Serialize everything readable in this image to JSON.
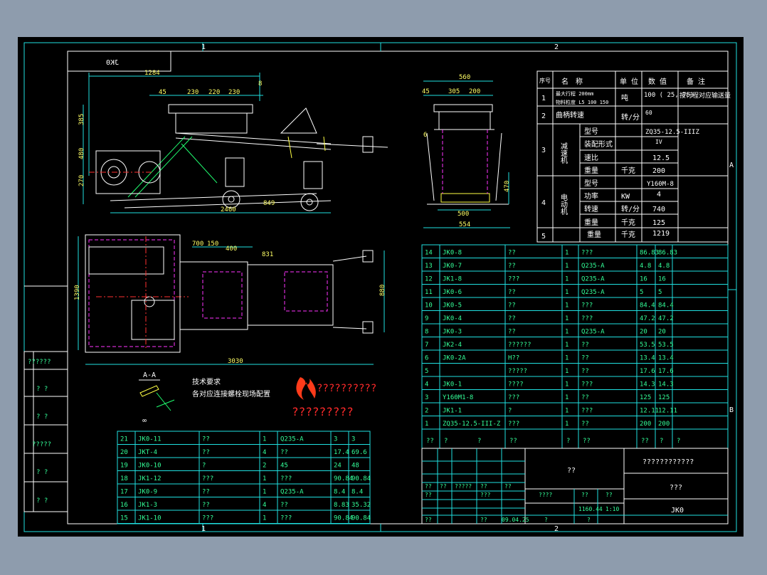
{
  "title_box": {
    "text": "JK0",
    "mirrored": true
  },
  "zones": {
    "top_1": "1",
    "top_2": "2",
    "bottom_1": "1",
    "bottom_2": "2",
    "right_a": "A",
    "right_b": "B"
  },
  "dims": {
    "side_overall": "1284",
    "side_45": "45",
    "side_230a": "230",
    "side_220": "220",
    "side_230b": "230",
    "side_8": "8",
    "side_385": "385",
    "side_480": "480",
    "side_270": "270",
    "side_2460": "2460",
    "side_849": "849",
    "end_560": "560",
    "end_45": "45",
    "end_305": "305",
    "end_200": "200",
    "end_6": "6",
    "end_470": "470",
    "end_500": "500",
    "end_554": "554",
    "plan_700": "700",
    "plan_150": "150",
    "plan_400": "400",
    "plan_831": "831",
    "plan_1390": "1390",
    "plan_880": "880",
    "plan_3030": "3030"
  },
  "section_label": "A-A",
  "notes": {
    "heading": "技术要求",
    "line1": "各对应连接螺栓现场配置"
  },
  "logo": {
    "text1": "??????????",
    "text2": "?????????",
    "colors": {
      "flame": "#ff3b1a",
      "text": "#ff2a2a"
    }
  },
  "spec_table": {
    "headers": [
      "序号",
      "名　称",
      "单 位",
      "数 值",
      "备 注"
    ],
    "rows": [
      {
        "no": "1",
        "name_l1": "最大行程 200mm",
        "name_l2": "物料粒度 L5 100 150",
        "unit": "吨",
        "value": "100 ( 25, 75)",
        "note": "按行程对应输送量"
      },
      {
        "no": "2",
        "name_l1": "曲柄转速",
        "unit": "转/分",
        "value": "60"
      },
      {
        "no": "3",
        "group": "减速机",
        "sub": [
          {
            "name": "型号",
            "unit": "",
            "value": "ZQ35-12.5-IIIZ"
          },
          {
            "name": "装配形式",
            "unit": "",
            "value": "IV"
          },
          {
            "name": "速比",
            "unit": "",
            "value": "12.5"
          },
          {
            "name": "重量",
            "unit": "千克",
            "value": "200"
          }
        ]
      },
      {
        "no": "4",
        "group": "电动机",
        "sub": [
          {
            "name": "型号",
            "unit": "",
            "value": "Y160M-8"
          },
          {
            "name": "功率",
            "unit": "KW",
            "value": "4"
          },
          {
            "name": "转速",
            "unit": "转/分",
            "value": "740"
          },
          {
            "name": "重量",
            "unit": "千克",
            "value": "125"
          }
        ]
      },
      {
        "no": "5",
        "name": "重量",
        "unit": "千克",
        "value": "1219"
      }
    ]
  },
  "bom_upper": [
    [
      "14",
      "JK0-8",
      "??",
      "1",
      "???",
      "86.83",
      "86.83"
    ],
    [
      "13",
      "JK0-7",
      "??",
      "1",
      "Q235-A",
      "4.8",
      "4.8"
    ],
    [
      "12",
      "JK1-8",
      "???",
      "1",
      "Q235-A",
      "16",
      "16"
    ],
    [
      "11",
      "JK0-6",
      "??",
      "1",
      "Q235-A",
      "5",
      "5"
    ],
    [
      "10",
      "JK0-5",
      "??",
      "1",
      "???",
      "84.4",
      "84.4"
    ],
    [
      "9",
      "JK0-4",
      "??",
      "1",
      "???",
      "47.2",
      "47.2"
    ],
    [
      "8",
      "JK0-3",
      "??",
      "1",
      "Q235-A",
      "20",
      "20"
    ],
    [
      "7",
      "JK2-4",
      "??????",
      "1",
      "??",
      "53.5",
      "53.5"
    ],
    [
      "6",
      "JK0-2A",
      "H??",
      "1",
      "??",
      "13.4",
      "13.4"
    ],
    [
      "5",
      "",
      "?????",
      "1",
      "??",
      "17.6",
      "17.6"
    ],
    [
      "4",
      "JK0-1",
      "????",
      "1",
      "???",
      "14.3",
      "14.3"
    ],
    [
      "3",
      "Y160M1-8",
      "???",
      "1",
      "??",
      "125",
      "125"
    ],
    [
      "2",
      "JK1-1",
      "?",
      "1",
      "???",
      "12.11",
      "12.11"
    ],
    [
      "1",
      "ZQ35-12.5-III-Z",
      "???",
      "1",
      "??",
      "200",
      "200"
    ]
  ],
  "bom_upper_header": [
    "??",
    "?",
    "?",
    "??",
    "?",
    "??",
    "??",
    "?",
    "?"
  ],
  "bom_lower": [
    [
      "21",
      "JK0-11",
      "??",
      "1",
      "Q235-A",
      "3",
      "3"
    ],
    [
      "20",
      "JKT-4",
      "??",
      "4",
      "??",
      "17.4",
      "69.6"
    ],
    [
      "19",
      "JK0-10",
      "?",
      "2",
      "45",
      "24",
      "48"
    ],
    [
      "18",
      "JK1-12",
      "???",
      "1",
      "???",
      "90.84",
      "90.84"
    ],
    [
      "17",
      "JK0-9",
      "??",
      "1",
      "Q235-A",
      "8.4",
      "8.4"
    ],
    [
      "16",
      "JK1-3",
      "??",
      "4",
      "??",
      "8.83",
      "35.32"
    ],
    [
      "15",
      "JK1-10",
      "???",
      "1",
      "???",
      "90.84",
      "90.84"
    ]
  ],
  "title_block": {
    "center": "??",
    "right_top": "????????????",
    "right_mid": "???",
    "right_bot": "JK0",
    "row_a": [
      "??",
      "??",
      "?????",
      "??",
      "??"
    ],
    "row_b": [
      "??",
      "???"
    ],
    "scale_hdr": [
      "????",
      "??",
      "??"
    ],
    "scale_val": [
      "1160.44",
      "1:10"
    ],
    "date": "09.04.25",
    "last_row": [
      "??",
      "??",
      "?",
      "?"
    ]
  },
  "left_strip": [
    "??????",
    "? ?",
    "? ?",
    "?????",
    "? ?",
    "? ?"
  ]
}
